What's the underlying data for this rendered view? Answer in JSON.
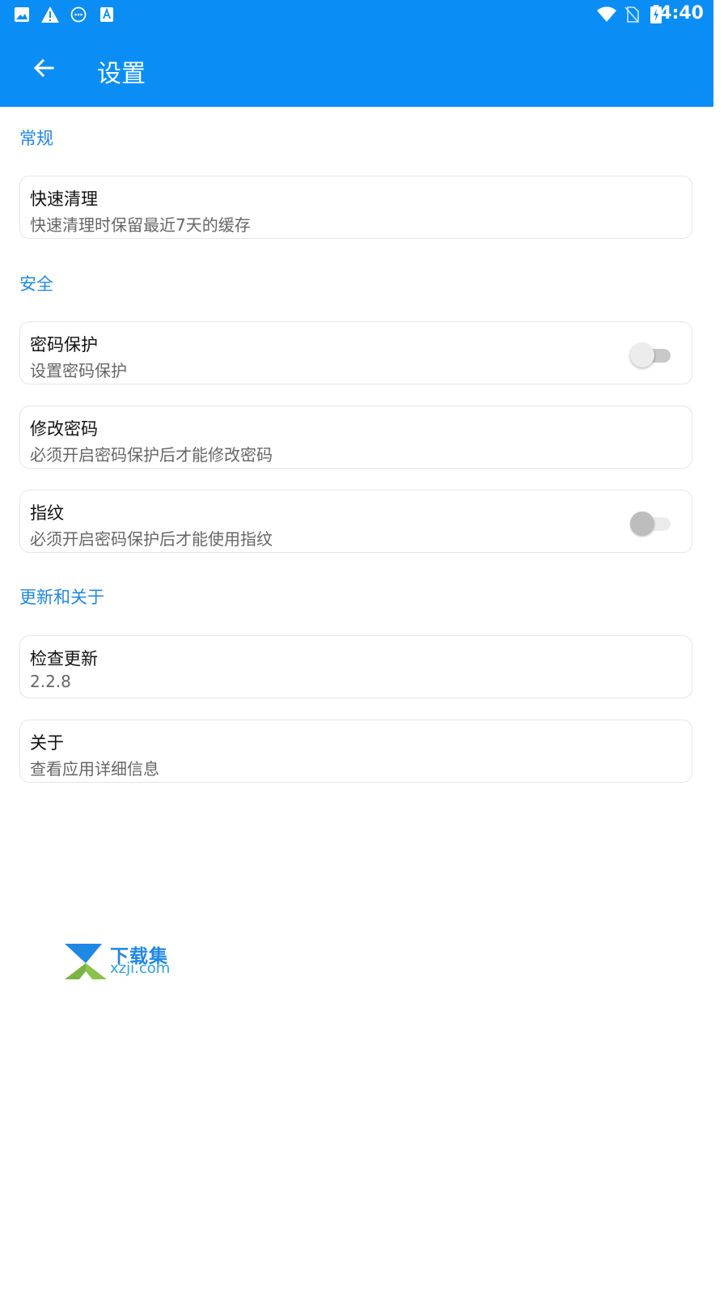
{
  "status_bar": {
    "time": "4:40",
    "icons": [
      "image-icon",
      "warning-icon",
      "chat-bubble-icon",
      "text-a-icon",
      "wifi-icon",
      "no-sim-icon",
      "battery-charging-icon"
    ]
  },
  "header": {
    "back_icon": "arrow-left-icon",
    "title": "设置",
    "color": "#0a8ef6"
  },
  "sections": {
    "general": {
      "title": "常规",
      "items": [
        {
          "title": "快速清理",
          "subtitle": "快速清理时保留最近7天的缓存"
        }
      ]
    },
    "security": {
      "title": "安全",
      "items": [
        {
          "title": "密码保护",
          "subtitle": "设置密码保护",
          "toggle": false
        },
        {
          "title": "修改密码",
          "subtitle": "必须开启密码保护后才能修改密码"
        },
        {
          "title": "指纹",
          "subtitle": "必须开启密码保护后才能使用指纹",
          "toggle": false,
          "disabled": true
        }
      ]
    },
    "about": {
      "title": "更新和关于",
      "items": [
        {
          "title": "检查更新",
          "subtitle": "2.2.8"
        },
        {
          "title": "关于",
          "subtitle": "查看应用详细信息"
        }
      ]
    }
  },
  "watermark": {
    "cn": "下载集",
    "en": "xzji.com"
  },
  "colors": {
    "accent": "#1e88e5",
    "appbar": "#0a8ef6"
  }
}
